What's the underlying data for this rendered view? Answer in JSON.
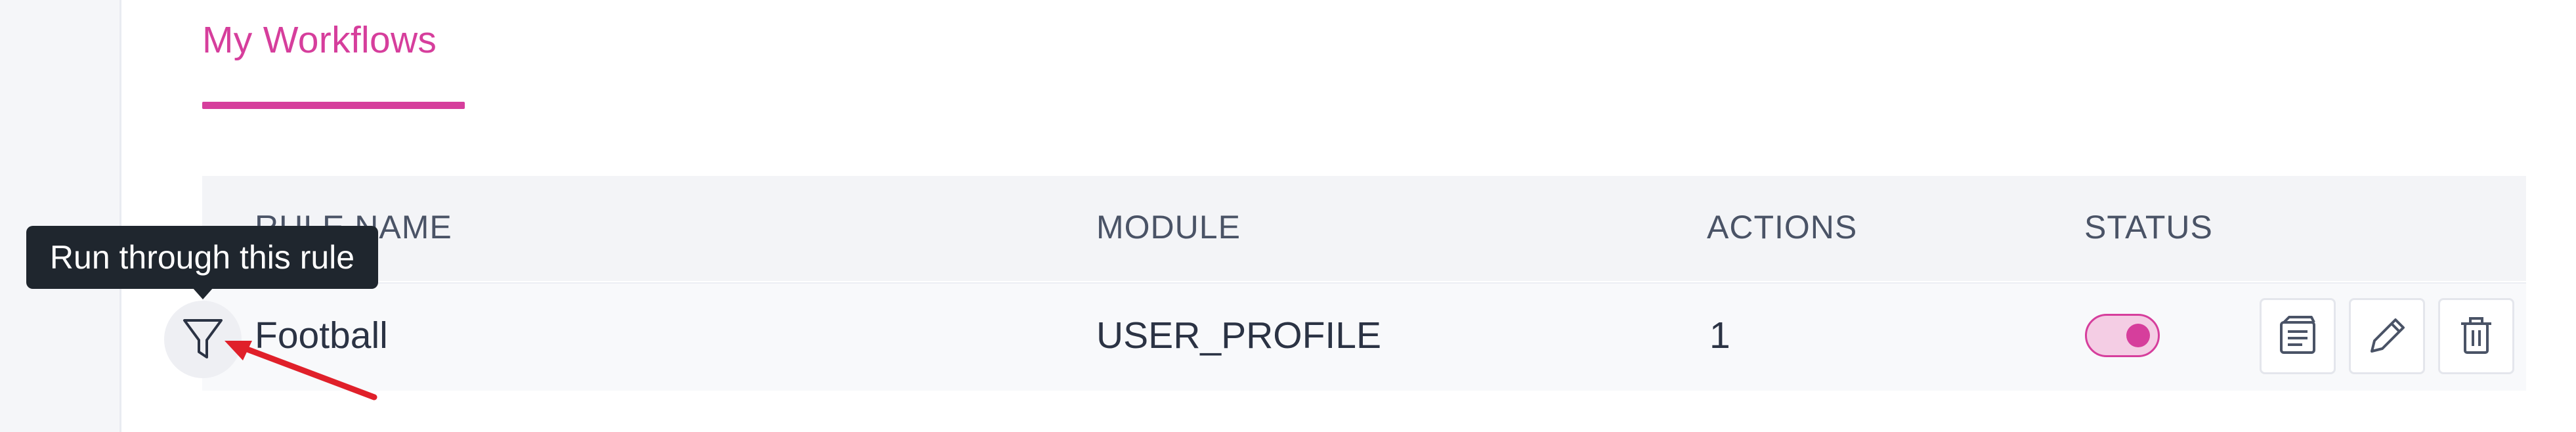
{
  "tabs": {
    "my_workflows": "My Workflows"
  },
  "table": {
    "headers": {
      "rule_name": "RULE NAME",
      "module": "MODULE",
      "actions": "ACTIONS",
      "status": "STATUS"
    },
    "rows": [
      {
        "rule_name": "Football",
        "module": "USER_PROFILE",
        "actions": "1",
        "status_enabled": true
      }
    ]
  },
  "tooltip": {
    "text": "Run through this rule"
  },
  "icons": {
    "filter": "funnel-icon",
    "view": "view-details-icon",
    "edit": "pencil-icon",
    "delete": "trash-icon"
  },
  "colors": {
    "accent": "#d63e9c",
    "annotation_arrow": "#e0202a",
    "tooltip_bg": "#1f262e"
  }
}
